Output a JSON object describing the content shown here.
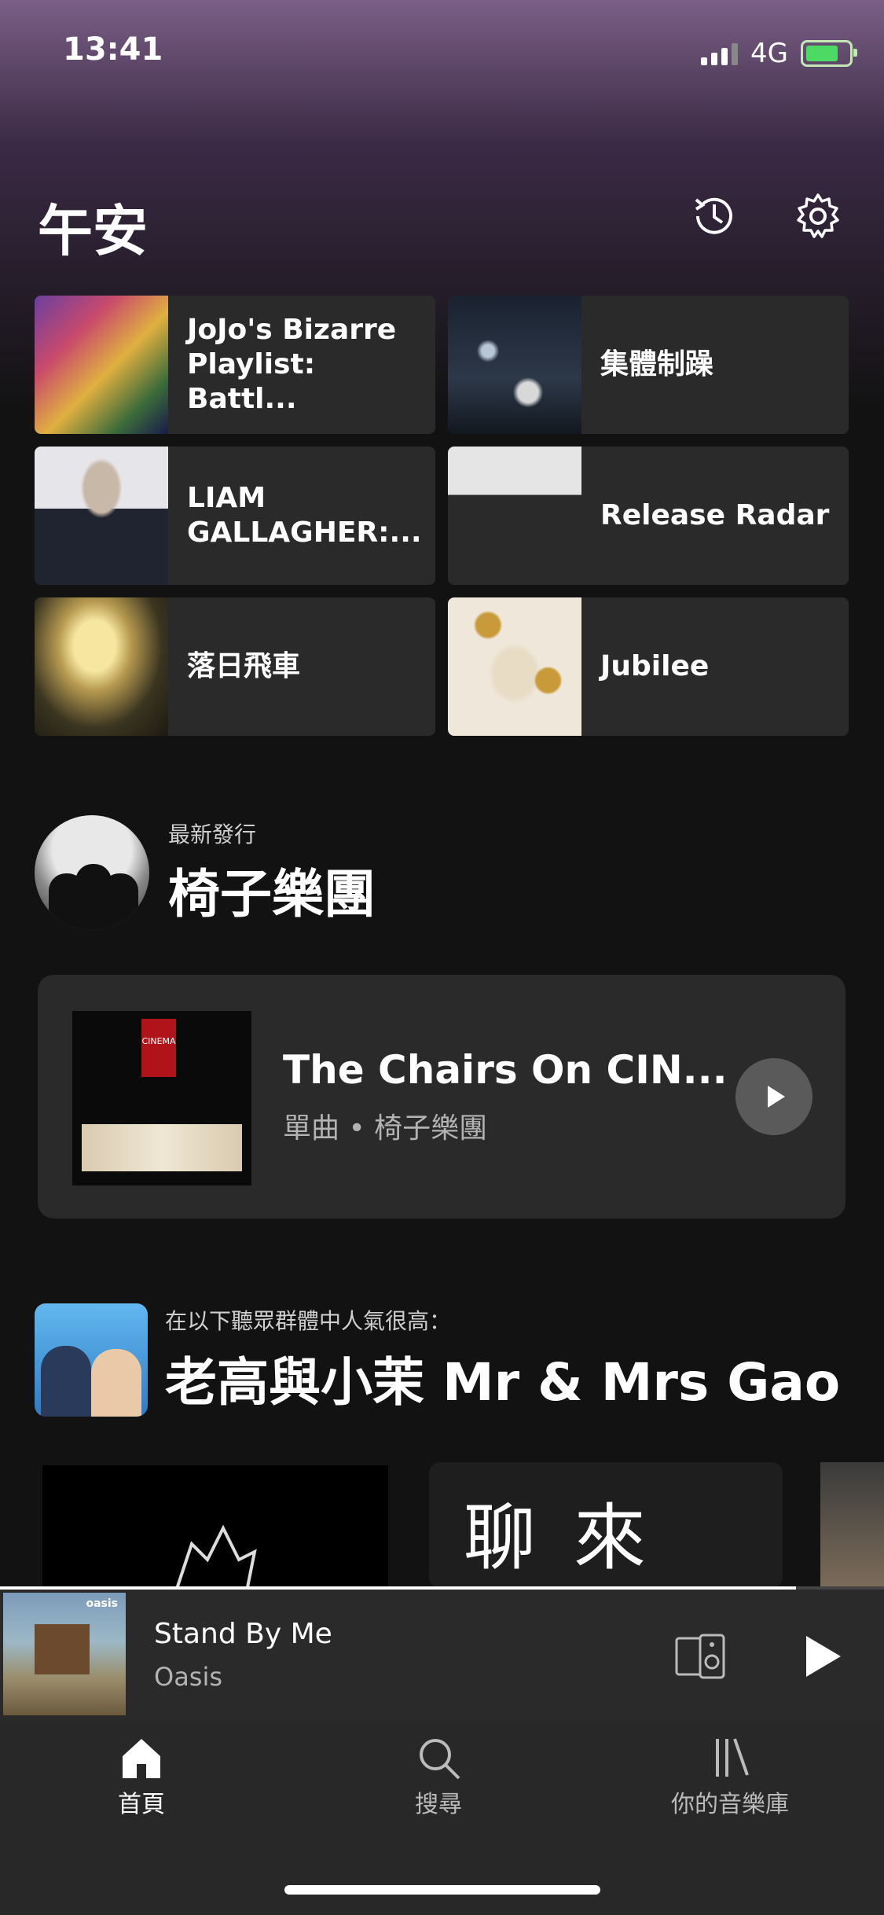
{
  "status_bar": {
    "time": "13:41",
    "network": "4G"
  },
  "header": {
    "greeting": "午安",
    "recents_icon": "history-icon",
    "settings_icon": "gear-icon"
  },
  "shortcuts": [
    {
      "label": "JoJo's Bizarre Playlist: Battl..."
    },
    {
      "label": "集體制躁"
    },
    {
      "label": "LIAM GALLAGHER:..."
    },
    {
      "label": "Release Radar"
    },
    {
      "label": "落日飛車"
    },
    {
      "label": "Jubilee"
    }
  ],
  "new_release": {
    "caption": "最新發行",
    "artist": "椅子樂團"
  },
  "release_card": {
    "title_prefix": "The ",
    "title_link": "Chairs On CIN...",
    "type": "單曲",
    "separator": " • ",
    "artist": "椅子樂團",
    "cover_text": "CINEMA"
  },
  "popular": {
    "caption": "在以下聽眾群體中人氣很高：",
    "name": "老高與小茉 Mr & Mrs Gao"
  },
  "row_cards": {
    "card2_chars": [
      "聊",
      "來"
    ]
  },
  "now_playing": {
    "title": "Stand By Me",
    "artist": "Oasis",
    "album_text": "oasis"
  },
  "tabs": [
    {
      "label": "首頁",
      "icon": "home-icon"
    },
    {
      "label": "搜尋",
      "icon": "search-icon"
    },
    {
      "label": "你的音樂庫",
      "icon": "library-icon"
    }
  ],
  "colors": {
    "background": "#121212",
    "tile": "#2a2a2a",
    "accent": "#1db954",
    "battery": "#4cd964"
  }
}
